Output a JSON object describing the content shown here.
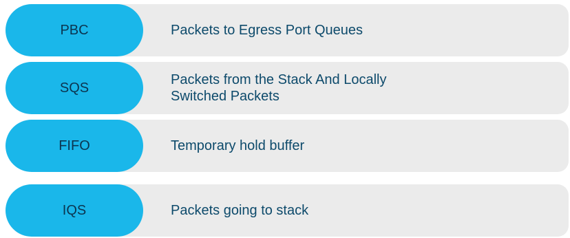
{
  "rows": [
    {
      "label": "PBC",
      "lines": [
        "Packets to Egress Port Queues"
      ]
    },
    {
      "label": "SQS",
      "lines": [
        "Packets from the Stack And Locally",
        "Switched Packets"
      ]
    },
    {
      "label": "FIFO",
      "lines": [
        "Temporary hold buffer"
      ]
    },
    {
      "label": "IQS",
      "lines": [
        "Packets going to stack"
      ]
    }
  ],
  "colors": {
    "pill": "#1ab7ea",
    "row_background": "#ebebeb",
    "description_text": "#0d4a6b",
    "pill_text": "#0b3550"
  }
}
